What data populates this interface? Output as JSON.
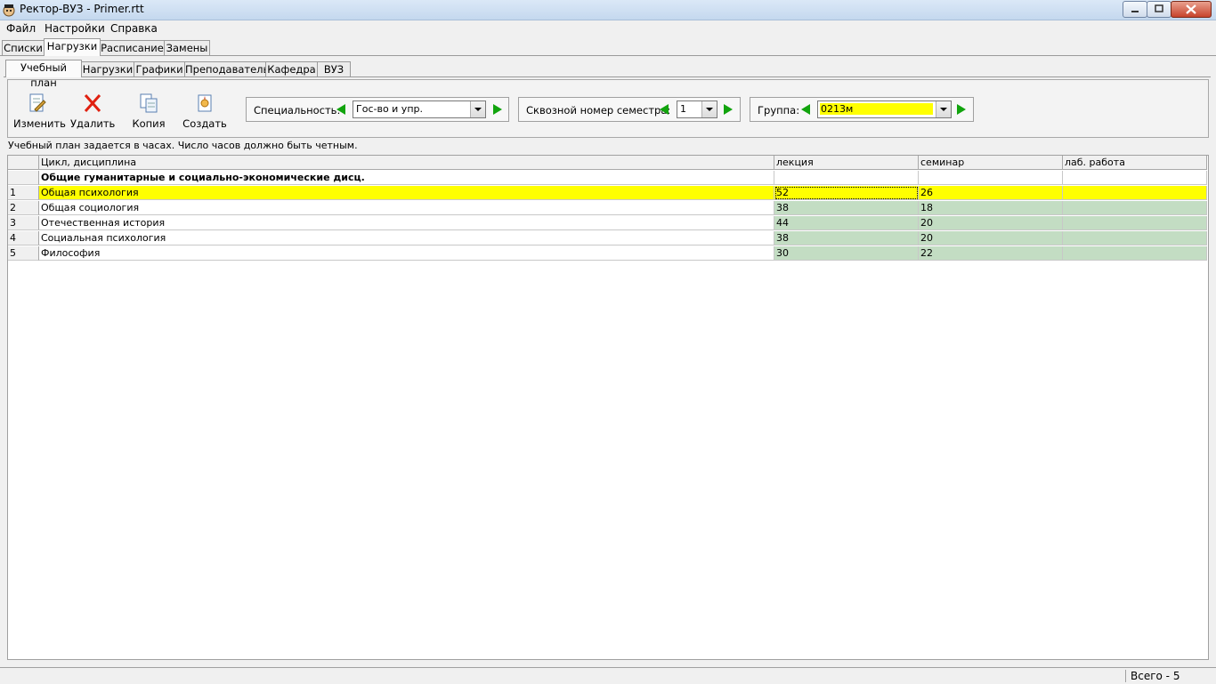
{
  "window": {
    "title": "Ректор-ВУЗ - Primer.rtt"
  },
  "menu": [
    "Файл",
    "Настройки",
    "Справка"
  ],
  "top_tabs": [
    "Списки",
    "Нагрузки",
    "Расписание",
    "Замены"
  ],
  "top_tab_active": "Нагрузки",
  "sub_tabs": [
    "Учебный план",
    "Нагрузки",
    "Графики",
    "Преподаватель",
    "Кафедра",
    "ВУЗ"
  ],
  "sub_tab_active": "Учебный план",
  "toolbar": {
    "edit_label": "Изменить",
    "delete_label": "Удалить",
    "copy_label": "Копия",
    "create_label": "Создать"
  },
  "filters": {
    "specialty_label": "Специальность:",
    "specialty_value": "Гос-во и упр.",
    "semester_label": "Сквозной номер семестра:",
    "semester_value": "1",
    "group_label": "Группа:",
    "group_value": "0213м"
  },
  "hint": "Учебный план задается в часах. Число часов должно быть четным.",
  "table": {
    "headers": [
      "Цикл, дисциплина",
      "лекция",
      "семинар",
      "лаб. работа"
    ],
    "group_header": "Общие гуманитарные и социально-экономические дисц.",
    "rows": [
      {
        "num": "1",
        "name": "Общая психология",
        "lecture": "52",
        "seminar": "26",
        "lab": ""
      },
      {
        "num": "2",
        "name": "Общая социология",
        "lecture": "38",
        "seminar": "18",
        "lab": ""
      },
      {
        "num": "3",
        "name": "Отечественная история",
        "lecture": "44",
        "seminar": "20",
        "lab": ""
      },
      {
        "num": "4",
        "name": "Социальная психология",
        "lecture": "38",
        "seminar": "20",
        "lab": ""
      },
      {
        "num": "5",
        "name": "Философия",
        "lecture": "30",
        "seminar": "22",
        "lab": ""
      }
    ]
  },
  "status": {
    "total": "Всего - 5"
  },
  "colors": {
    "highlight": "#ffff00",
    "value_cells": "#c3ddc3",
    "arrow": "#12a40e"
  }
}
